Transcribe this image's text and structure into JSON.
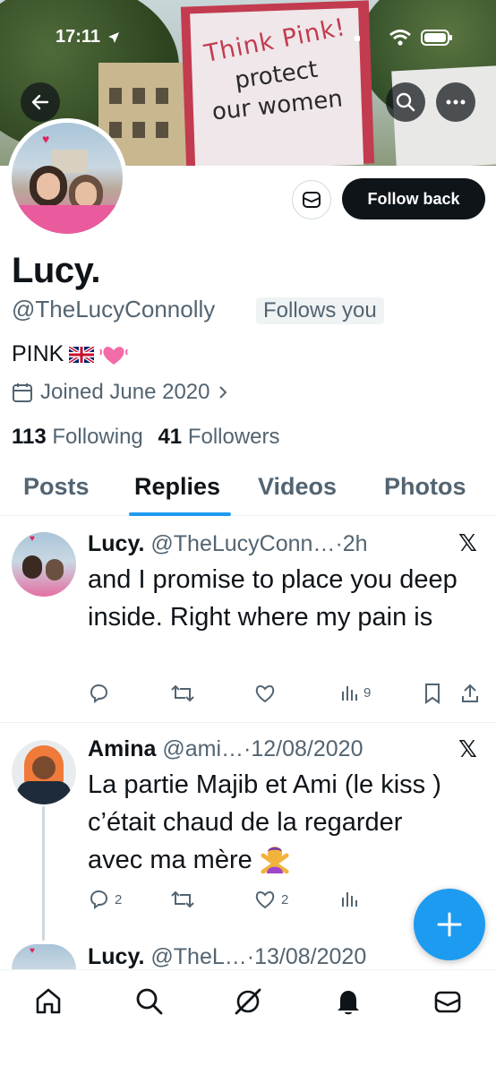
{
  "status_bar": {
    "time": "17:11"
  },
  "banner": {
    "sign_line1": "Think Pink!",
    "sign_line2": "protect",
    "sign_line3": "our women"
  },
  "profile": {
    "name": "Lucy.",
    "handle": "@TheLucyConnolly",
    "follows_you": "Follows you",
    "bio": "PINK",
    "joined": "Joined June 2020",
    "following_count": "113",
    "following_label": "Following",
    "followers_count": "41",
    "followers_label": "Followers",
    "follow_back_label": "Follow back"
  },
  "tabs": [
    {
      "label": "Posts"
    },
    {
      "label": "Replies"
    },
    {
      "label": "Videos"
    },
    {
      "label": "Photos"
    }
  ],
  "active_tab": "Replies",
  "posts": [
    {
      "name": "Lucy.",
      "handle": "@TheLucyConn…",
      "time": "·2h",
      "text": "and I promise to place you deep inside. Right where my pain is",
      "views": "9"
    },
    {
      "name": "Amina",
      "handle": "@ami…",
      "time": "·12/08/2020",
      "text": "La partie Majib et Ami  (le kiss ) c’était chaud de la regarder avec ma mère",
      "replies": "2",
      "likes": "2"
    },
    {
      "name": "Lucy.",
      "handle": "@TheL…",
      "time": "·13/08/2020"
    }
  ],
  "colors": {
    "accent": "#1d9bf0",
    "text": "#0f1419",
    "secondary": "#536471"
  }
}
